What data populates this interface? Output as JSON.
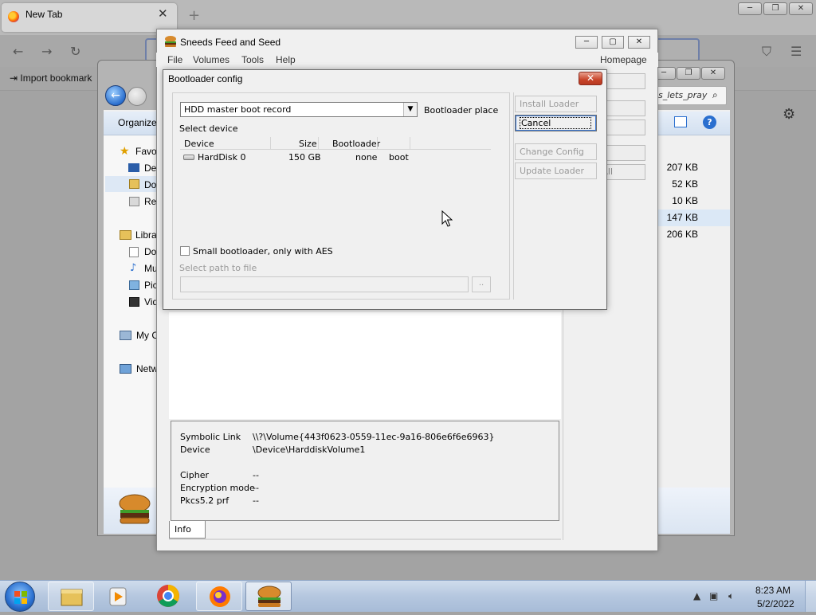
{
  "firefox": {
    "tab_title": "New Tab",
    "tab_close": "✕",
    "new_tab": "+",
    "back": "←",
    "forward": "→",
    "reload": "↻",
    "pocket": "⛉",
    "menu": "☰",
    "import_bookmarks": "⇥ Import bookmark",
    "settings": "⚙"
  },
  "explorer": {
    "organize": "Organize",
    "search_placeholder": "s_lets_pray",
    "nav": {
      "favorites": "Favo",
      "desktop": "De",
      "downloads": "Do",
      "recent": "Re",
      "libraries": "Libra",
      "documents": "Do",
      "music": "Mu",
      "pictures": "Pic",
      "videos": "Vid",
      "computer": "My C",
      "network": "Netw"
    },
    "sizes": [
      "207 KB",
      "52 KB",
      "10 KB",
      "147 KB",
      "206 KB"
    ],
    "all_label": "All"
  },
  "sfs": {
    "title": "Sneeds Feed and Seed",
    "menu": {
      "file": "File",
      "volumes": "Volumes",
      "tools": "Tools",
      "help": "Help",
      "homepage": "Homepage"
    },
    "info": {
      "symbolic_link_label": "Symbolic Link",
      "symbolic_link_value": "\\\\?\\Volume{443f0623-0559-11ec-9a16-806e6f6e6963}",
      "device_label": "Device",
      "device_value": "\\Device\\HarddiskVolume1",
      "cipher_label": "Cipher",
      "cipher_value": "--",
      "encryption_mode_label": "Encryption mode",
      "encryption_mode_value": "--",
      "pkcs_label": "Pkcs5.2 prf",
      "pkcs_value": "--",
      "tab_label": "Info"
    }
  },
  "dialog": {
    "title": "Bootloader config",
    "close": "✕",
    "place_value": "HDD master boot record",
    "place_label": "Bootloader place",
    "select_device": "Select device",
    "columns": {
      "device": "Device",
      "size": "Size",
      "bootloader": "Bootloader"
    },
    "rows": [
      {
        "device": "HardDisk 0",
        "size": "150 GB",
        "bootloader": "none",
        "extra": "boot"
      }
    ],
    "small_bootloader": "Small bootloader, only with AES",
    "select_path": "Select path to file",
    "browse": "..",
    "buttons": {
      "install": "Install Loader",
      "cancel": "Cancel",
      "change": "Change Config",
      "update": "Update Loader"
    }
  },
  "taskbar": {
    "time": "8:23 AM",
    "date": "5/2/2022"
  },
  "colors": {
    "close_red": "#c8452a",
    "taskbar": "#b5c7df",
    "selection": "#3b7ad8"
  }
}
